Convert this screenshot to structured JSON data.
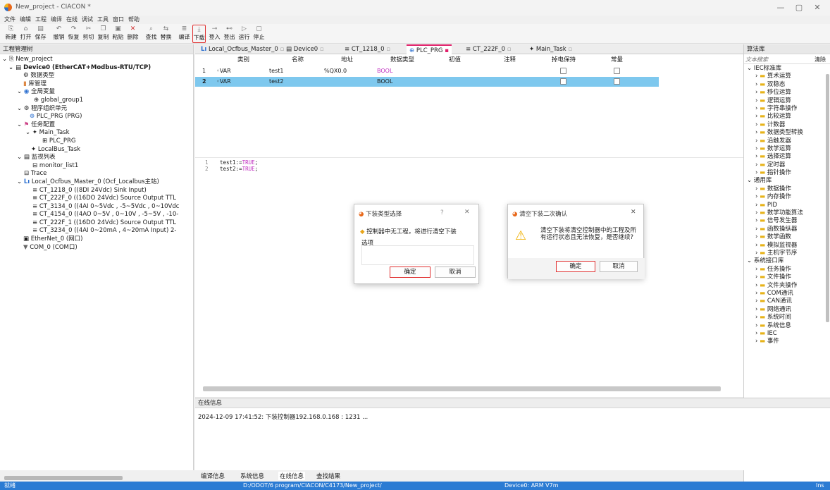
{
  "window": {
    "title": "New_project - CIACON *"
  },
  "menu": [
    "文件",
    "编辑",
    "工程",
    "编译",
    "在线",
    "调试",
    "工具",
    "窗口",
    "帮助"
  ],
  "toolbar": [
    {
      "label": "新建",
      "icon": "new-file-icon"
    },
    {
      "label": "打开",
      "icon": "open-folder-icon"
    },
    {
      "label": "保存",
      "icon": "save-icon"
    },
    {
      "label": "撤销",
      "icon": "undo-icon"
    },
    {
      "label": "恢复",
      "icon": "redo-icon"
    },
    {
      "label": "剪切",
      "icon": "cut-icon"
    },
    {
      "label": "复制",
      "icon": "copy-icon"
    },
    {
      "label": "粘贴",
      "icon": "paste-icon"
    },
    {
      "label": "删除",
      "icon": "delete-icon"
    },
    {
      "label": "查找",
      "icon": "find-icon"
    },
    {
      "label": "替换",
      "icon": "replace-icon"
    },
    {
      "label": "编译",
      "icon": "compile-icon"
    },
    {
      "label": "下载",
      "icon": "download-icon"
    },
    {
      "label": "登入",
      "icon": "login-icon"
    },
    {
      "label": "登出",
      "icon": "logout-icon"
    },
    {
      "label": "运行",
      "icon": "run-icon"
    },
    {
      "label": "停止",
      "icon": "stop-icon"
    }
  ],
  "project_panel": {
    "title": "工程管理树",
    "tree": [
      "New_project",
      "Device0 (EtherCAT+Modbus-RTU/TCP)",
      "数据类型",
      "库管理",
      "全局变量",
      "global_group1",
      "程序组织单元",
      "PLC_PRG (PRG)",
      "任务配置",
      "Main_Task",
      "PLC_PRG",
      "LocalBus_Task",
      "监视列表",
      "monitor_list1",
      "Trace",
      "Local_Ocfbus_Master_0 (Ocf_Localbus主站)",
      "CT_1218_0 ((8DI 24Vdc) Sink Input)",
      "CT_222F_0 ((16DO 24Vdc) Source Output TTL",
      "CT_3134_0 ((4AI 0~5Vdc , -5~5Vdc , 0~10Vdc",
      "CT_4154_0 ((4AO 0~5V , 0~10V , -5~5V , -10-",
      "CT_222F_1 ((16DO 24Vdc) Source Output TTL",
      "CT_3234_0 ((4AI 0~20mA , 4~20mA Input) 2-",
      "EtherNet_0 (网口)",
      "COM_0 (COM口)"
    ]
  },
  "tabs": [
    "Local_Ocfbus_Master_0",
    "Device0",
    "CT_1218_0",
    "PLC_PRG",
    "CT_222F_0",
    "Main_Task"
  ],
  "var_table": {
    "headers": [
      "类别",
      "名称",
      "地址",
      "数据类型",
      "初值",
      "注释",
      "掉电保持",
      "常量"
    ],
    "rows": [
      {
        "no": "1",
        "cat": "VAR",
        "name": "test1",
        "addr": "%QX0.0",
        "type": "BOOL"
      },
      {
        "no": "2",
        "cat": "VAR",
        "name": "test2",
        "addr": "",
        "type": "BOOL"
      }
    ]
  },
  "code": [
    {
      "no": "1",
      "var": "test1",
      "op": ":=",
      "val": "TRUE",
      "end": ";"
    },
    {
      "no": "2",
      "var": "test2",
      "op": ":=",
      "val": "TRUE",
      "end": ";"
    }
  ],
  "dialog1": {
    "title": "下装类型选择",
    "help": "?",
    "message": "控制器中无工程，将进行清空下装",
    "options_label": "选项",
    "ok": "确定",
    "cancel": "取消"
  },
  "dialog2": {
    "title": "清空下装二次确认",
    "message": "清空下装将清空控制器中的工程及所有运行状态且无法恢复，是否继续?",
    "ok": "确定",
    "cancel": "取消"
  },
  "library": {
    "title": "算法库",
    "search_placeholder": "文本搜索",
    "clear": "清除",
    "tree": [
      {
        "t": "IEC标准库",
        "lvl": 0
      },
      {
        "t": "算术运算",
        "lvl": 1
      },
      {
        "t": "双稳态",
        "lvl": 1
      },
      {
        "t": "移位运算",
        "lvl": 1
      },
      {
        "t": "逻辑运算",
        "lvl": 1
      },
      {
        "t": "字符串操作",
        "lvl": 1
      },
      {
        "t": "比较运算",
        "lvl": 1
      },
      {
        "t": "计数器",
        "lvl": 1
      },
      {
        "t": "数据类型转换",
        "lvl": 1
      },
      {
        "t": "沿触发器",
        "lvl": 1
      },
      {
        "t": "数学运算",
        "lvl": 1
      },
      {
        "t": "选择运算",
        "lvl": 1
      },
      {
        "t": "定时器",
        "lvl": 1
      },
      {
        "t": "指针操作",
        "lvl": 1
      },
      {
        "t": "通用库",
        "lvl": 0
      },
      {
        "t": "数据操作",
        "lvl": 1
      },
      {
        "t": "内存操作",
        "lvl": 1
      },
      {
        "t": "PID",
        "lvl": 1
      },
      {
        "t": "数学功能算法",
        "lvl": 1
      },
      {
        "t": "信号发生器",
        "lvl": 1
      },
      {
        "t": "函数操纵器",
        "lvl": 1
      },
      {
        "t": "数学函数",
        "lvl": 1
      },
      {
        "t": "模拟监视器",
        "lvl": 1
      },
      {
        "t": "主机字节序",
        "lvl": 1
      },
      {
        "t": "系统接口库",
        "lvl": 0
      },
      {
        "t": "任务操作",
        "lvl": 1
      },
      {
        "t": "文件操作",
        "lvl": 1
      },
      {
        "t": "文件夹操作",
        "lvl": 1
      },
      {
        "t": "COM通讯",
        "lvl": 1
      },
      {
        "t": "CAN通讯",
        "lvl": 1
      },
      {
        "t": "网络通讯",
        "lvl": 1
      },
      {
        "t": "系统时间",
        "lvl": 1
      },
      {
        "t": "系统信息",
        "lvl": 1
      },
      {
        "t": "IEC",
        "lvl": 1
      },
      {
        "t": "事件",
        "lvl": 1
      }
    ]
  },
  "online": {
    "title": "在线信息",
    "message": "2024-12-09 17:41:52:  下装控制器192.168.0.168 : 1231 ..."
  },
  "bottom_tabs": [
    "编译信息",
    "系统信息",
    "在线信息",
    "查找结果"
  ],
  "status": {
    "left": "就绪",
    "path": "D:/ODOT/6 program/CIACON/C4173/New_project/",
    "device": "Device0: ARM V7m",
    "mode": "Ins"
  },
  "colors": {
    "accent": "#2b7bd3",
    "highlight_row": "#7ec8ee",
    "ok_border": "#e03030",
    "active_tab": "#e0206a"
  }
}
